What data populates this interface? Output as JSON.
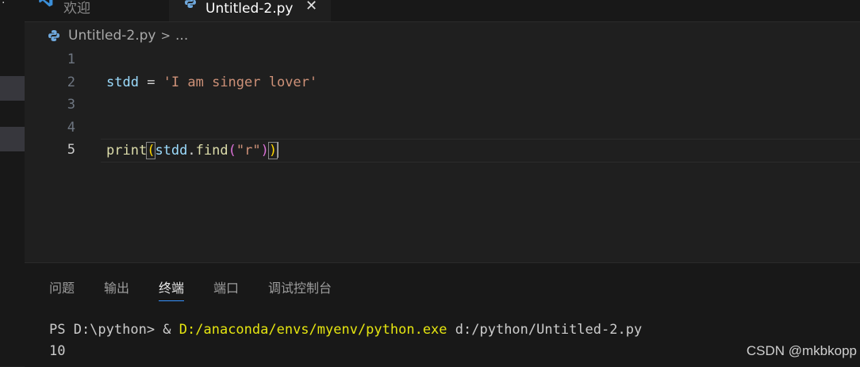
{
  "tabs": [
    {
      "label": "欢迎",
      "icon": "vscode-icon"
    },
    {
      "label": "Untitled-2.py",
      "icon": "python-icon",
      "close": "✕"
    }
  ],
  "breadcrumb": {
    "file": "Untitled-2.py",
    "sep": ">",
    "more": "..."
  },
  "editor": {
    "line_numbers": [
      "1",
      "2",
      "3",
      "4",
      "5"
    ],
    "line2": {
      "var": "stdd",
      "op": " = ",
      "str": "'I am singer lover'"
    },
    "line5": {
      "fn1": "print",
      "p1": "(",
      "var": "stdd",
      "dot": ".",
      "fn2": "find",
      "p2": "(",
      "str": "\"r\"",
      "p3": ")",
      "p4": ")"
    }
  },
  "panel": {
    "tabs": [
      "问题",
      "输出",
      "终端",
      "端口",
      "调试控制台"
    ],
    "terminal": {
      "prompt": "PS D:\\python> ",
      "amp": "& ",
      "exe": "D:/anaconda/envs/myenv/python.exe",
      "arg": " d:/python/Untitled-2.py",
      "output": "10"
    }
  },
  "watermark": "CSDN @mkbkopp"
}
